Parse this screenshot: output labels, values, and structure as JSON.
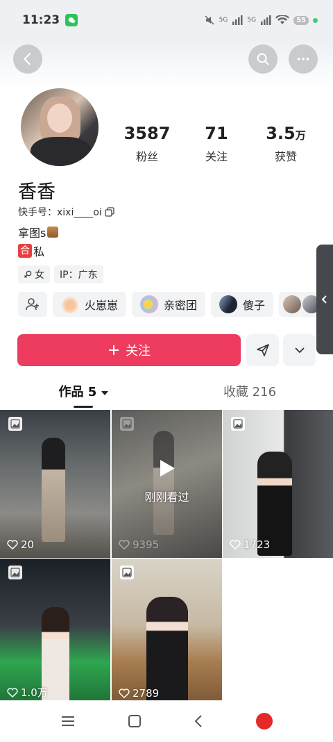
{
  "status": {
    "time": "11:23",
    "battery": "55",
    "signal1": "5G",
    "signal2": "5G"
  },
  "profile": {
    "nickname": "香香",
    "kuaishou_id": "快手号：xixi____oi",
    "bio_line1": "拿图s",
    "bio_line2_badge": "合",
    "bio_line2_text": "私"
  },
  "stats": [
    {
      "value": "3587",
      "unit": "",
      "label": "粉丝"
    },
    {
      "value": "71",
      "unit": "",
      "label": "关注"
    },
    {
      "value": "3.5",
      "unit": "万",
      "label": "获赞"
    }
  ],
  "tags": {
    "gender": "女",
    "ip": "IP：广东"
  },
  "friends": [
    {
      "label": "火崽崽"
    },
    {
      "label": "亲密团"
    },
    {
      "label": "傻子"
    }
  ],
  "actions": {
    "follow_label": "关注"
  },
  "tabs": {
    "works": "作品 5",
    "favorites": "收藏 216"
  },
  "posts": [
    {
      "likes": "20"
    },
    {
      "likes": "9395",
      "overlay": "刚刚看过"
    },
    {
      "likes": "1723"
    },
    {
      "likes": "1.0万"
    },
    {
      "likes": "2789"
    }
  ],
  "colors": {
    "accent": "#ee3c5e",
    "status_bar": "#eef0f4"
  }
}
